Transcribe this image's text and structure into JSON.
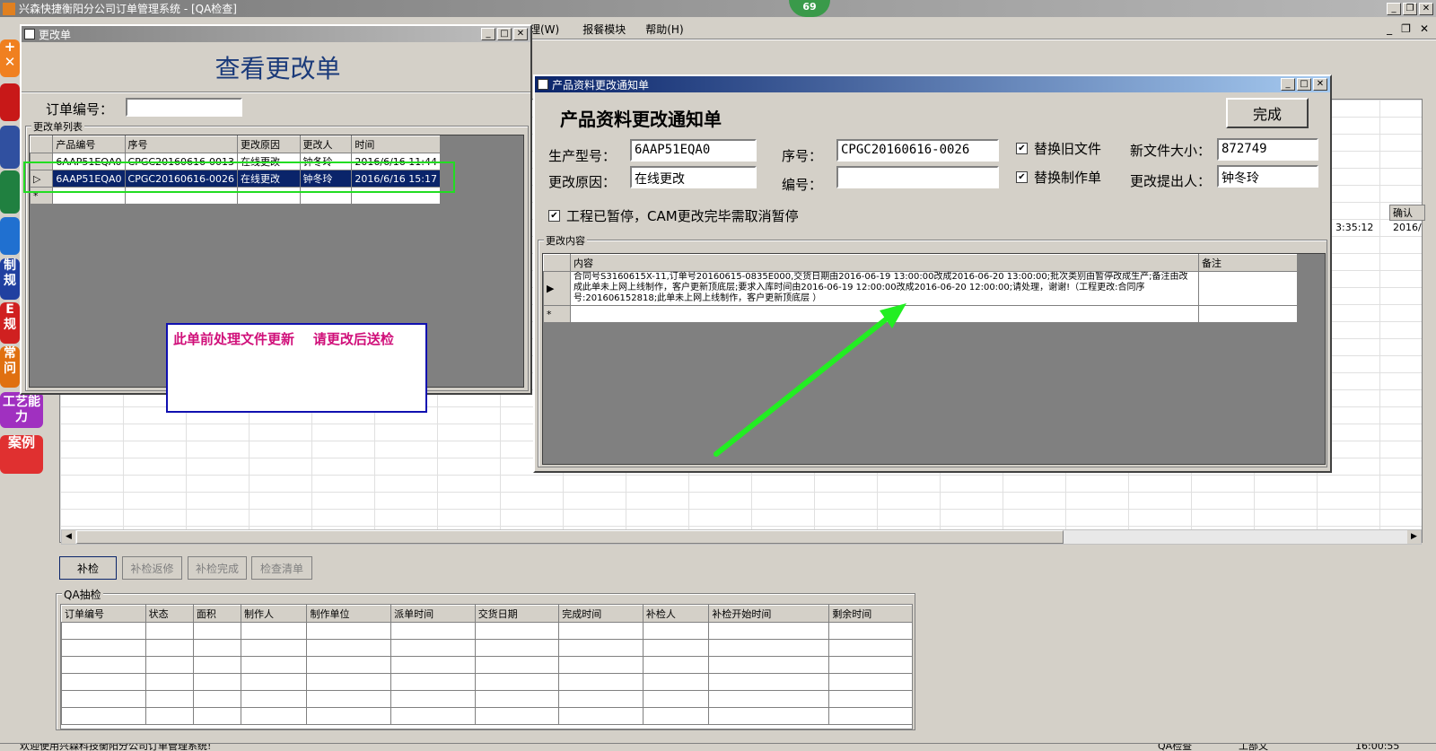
{
  "app": {
    "title": "兴森快捷衡阳分公司订单管理系统 - [QA检查]",
    "badge": "69"
  },
  "menu": [
    {
      "label": "理(W)"
    },
    {
      "label": "报餐模块"
    },
    {
      "label": "帮助(H)"
    }
  ],
  "sidebar": [
    {
      "label": ""
    },
    {
      "label": ""
    },
    {
      "label": ""
    },
    {
      "label": ""
    },
    {
      "label": "制规"
    },
    {
      "label": "E规"
    },
    {
      "label": "常问"
    },
    {
      "label": "工艺能力"
    },
    {
      "label": "案例"
    }
  ],
  "change_list_window": {
    "title": "更改单",
    "heading": "查看更改单",
    "order_label": "订单编号：",
    "order_value": "",
    "group_label": "更改单列表",
    "columns": [
      "产品编号",
      "序号",
      "更改原因",
      "更改人",
      "时间"
    ],
    "rows": [
      {
        "product": "6AAP51EQA0",
        "seq": "CPGC20160616-0013",
        "reason": "在线更改",
        "person": "钟冬玲",
        "time": "2016/6/16 11:44"
      },
      {
        "product": "6AAP51EQA0",
        "seq": "CPGC20160616-0026",
        "reason": "在线更改",
        "person": "钟冬玲",
        "time": "2016/6/16 15:17"
      }
    ]
  },
  "annotation": {
    "text": "此单前处理文件更新    请更改后送检"
  },
  "notice_window": {
    "title": "产品资料更改通知单",
    "heading": "产品资料更改通知单",
    "done_button": "完成",
    "labels": {
      "model": "生产型号：",
      "reason": "更改原因：",
      "seq": "序号：",
      "code": "编号：",
      "new_size": "新文件大小：",
      "proposer": "更改提出人："
    },
    "values": {
      "model": "6AAP51EQA0",
      "reason": "在线更改",
      "seq": "CPGC20160616-0026",
      "code": "",
      "new_size": "872749",
      "proposer": "钟冬玲"
    },
    "checks": {
      "replace_old": "替换旧文件",
      "replace_order": "替换制作单",
      "paused": "工程已暂停，CAM更改完毕需取消暂停"
    },
    "content_group": "更改内容",
    "content_cols": [
      "内容",
      "备注"
    ],
    "content": "合同号S3160615X-11,订单号20160615-0835E000,交货日期由2016-06-19 13:00:00改成2016-06-20 13:00:00;批次类别由暂停改成生产;备注由改成此单未上网上线制作，客户更新顶底层;要求入库时间由2016-06-19 12:00:00改成2016-06-20 12:00:00;请处理，谢谢!（工程更改:合同序号:201606152818;此单未上网上线制作，客户更新顶底层 ）",
    "remark": ""
  },
  "right_grid": {
    "header": "确认",
    "time": "3:35:12",
    "date": "2016/"
  },
  "buttons": {
    "recheck": "补检",
    "recheck_return": "补检返修",
    "recheck_done": "补检完成",
    "check_list": "检查清单"
  },
  "qa": {
    "group": "QA抽检",
    "columns": [
      "订单编号",
      "状态",
      "面积",
      "制作人",
      "制作单位",
      "派单时间",
      "交货日期",
      "完成时间",
      "补检人",
      "补检开始时间",
      "剩余时间"
    ]
  },
  "status": {
    "left": "欢迎使用兴森科技衡阳分公司订单管理系统!",
    "mid": "QA检查",
    "dept": "工部文",
    "time": "16:00:55"
  }
}
